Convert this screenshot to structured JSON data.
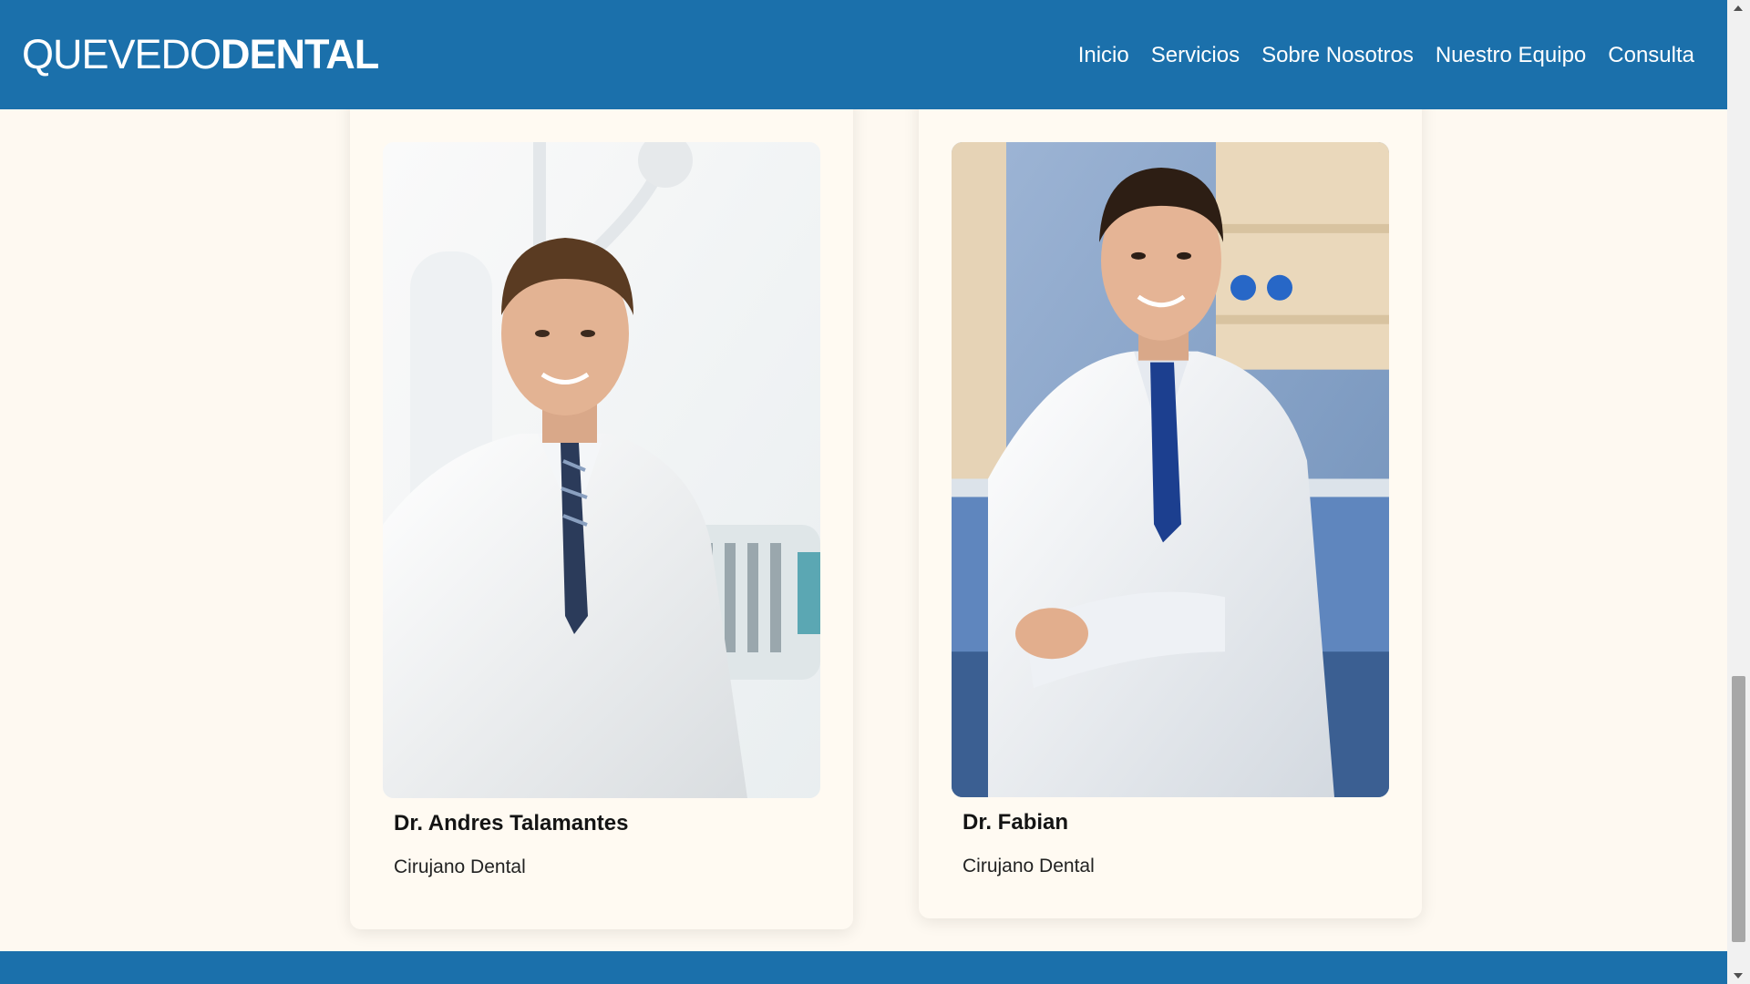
{
  "brand": {
    "logo_light": "QUEVEDO",
    "logo_bold": "DENTAL",
    "primary_color": "#1b70ab",
    "background_color": "#fef9f1"
  },
  "nav": {
    "items": [
      {
        "label": "Inicio"
      },
      {
        "label": "Servicios"
      },
      {
        "label": "Sobre Nosotros"
      },
      {
        "label": "Nuestro Equipo"
      },
      {
        "label": "Consulta"
      }
    ]
  },
  "team": [
    {
      "name": "Dr. Andres Talamantes",
      "role": "Cirujano Dental",
      "photo_icon": "dentist-portrait-image"
    },
    {
      "name": "Dr. Fabian",
      "role": "Cirujano Dental",
      "photo_icon": "dentist-portrait-image"
    }
  ],
  "scrollbar": {
    "position_fraction": 0.78
  }
}
